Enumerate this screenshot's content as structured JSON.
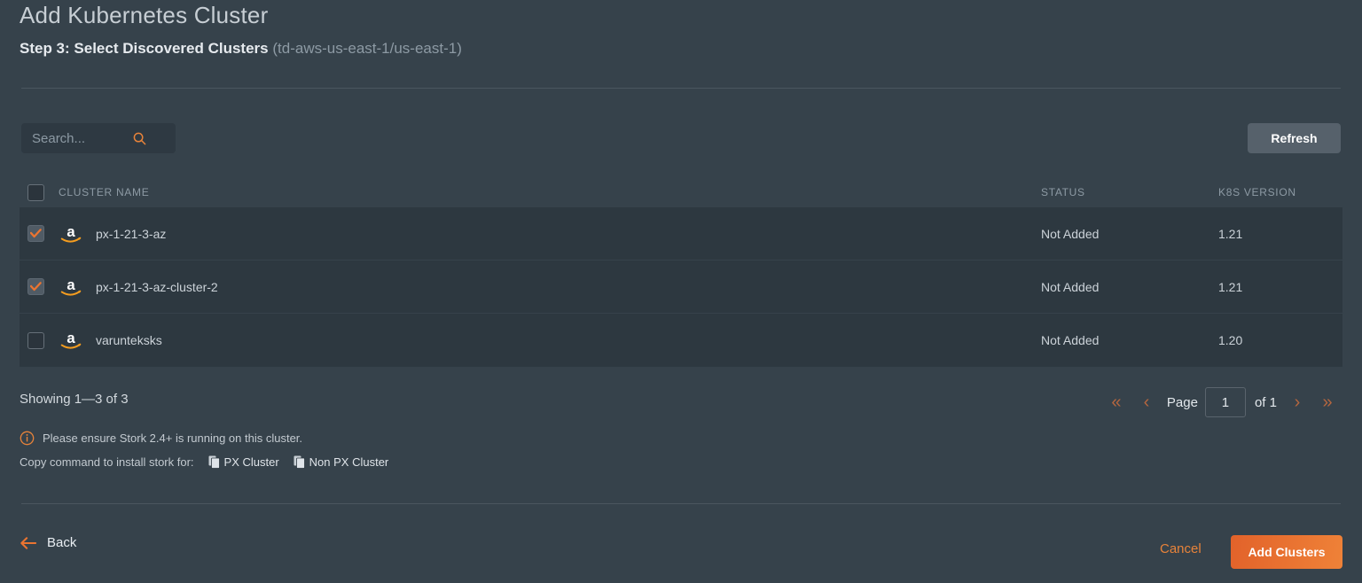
{
  "header": {
    "title": "Add Kubernetes Cluster",
    "step": "Step 3: Select Discovered Clusters",
    "context": "(td-aws-us-east-1/us-east-1)"
  },
  "toolbar": {
    "search_placeholder": "Search...",
    "search_value": "",
    "search_icon": "search-icon",
    "refresh_label": "Refresh"
  },
  "table": {
    "columns": {
      "name": "CLUSTER NAME",
      "status": "STATUS",
      "version": "K8S VERSION"
    },
    "select_all_checked": false,
    "rows": [
      {
        "provider_icon": "aws-logo",
        "name": "px-1-21-3-az",
        "status": "Not Added",
        "version": "1.21",
        "checked": true
      },
      {
        "provider_icon": "aws-logo",
        "name": "px-1-21-3-az-cluster-2",
        "status": "Not Added",
        "version": "1.21",
        "checked": true
      },
      {
        "provider_icon": "aws-logo",
        "name": "varunteksks",
        "status": "Not Added",
        "version": "1.20",
        "checked": false
      }
    ]
  },
  "footer": {
    "showing": "Showing 1—3 of 3",
    "pager": {
      "first_icon": "«",
      "prev_icon": "‹",
      "page_label": "Page",
      "page_value": "1",
      "of_label": "of 1",
      "next_icon": "›",
      "last_icon": "»"
    }
  },
  "notes": {
    "info_icon": "info-circle-icon",
    "stork_note": "Please ensure Stork 2.4+ is running on this cluster.",
    "copy_prefix": "Copy command to install stork for:",
    "copy_px_label": "PX Cluster",
    "copy_nonpx_label": "Non PX Cluster"
  },
  "actions": {
    "back_label": "Back",
    "back_icon": "arrow-left-icon",
    "cancel_label": "Cancel",
    "add_label": "Add Clusters"
  },
  "colors": {
    "page_bg": "#36424b",
    "row_bg": "#2d3840",
    "accent": "#e8833a",
    "primary_button": "#ea7431",
    "muted_text": "#8d9aa4"
  }
}
